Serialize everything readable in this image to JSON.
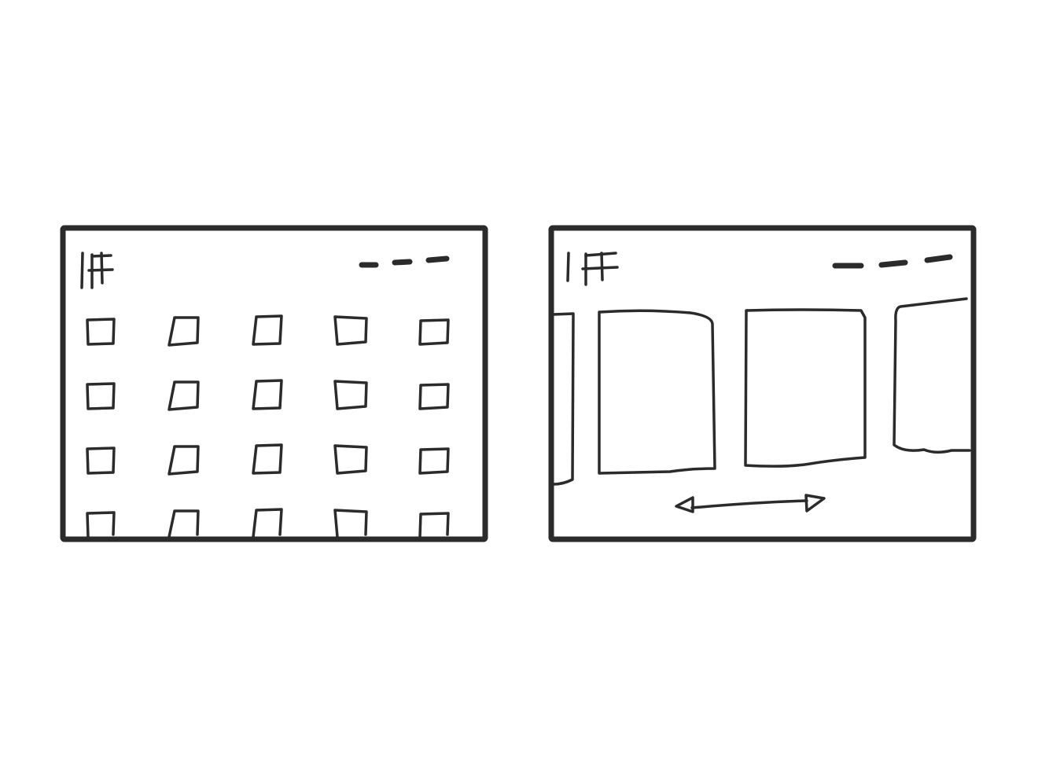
{
  "colors": {
    "ink": "#2b2b2b",
    "background": "#ffffff"
  },
  "left_panel": {
    "logo_text": "IFF",
    "menu_dashes": 3,
    "grid": {
      "columns": 5,
      "rows": 4,
      "last_row_cut_off": true
    }
  },
  "right_panel": {
    "logo_text": "IFF",
    "menu_dashes": 3,
    "carousel": {
      "visible_cards": 2,
      "partial_cards_at_edges": true,
      "scroll_direction": "horizontal"
    },
    "scroll_indicator_icon": "double-headed-arrow-icon"
  }
}
